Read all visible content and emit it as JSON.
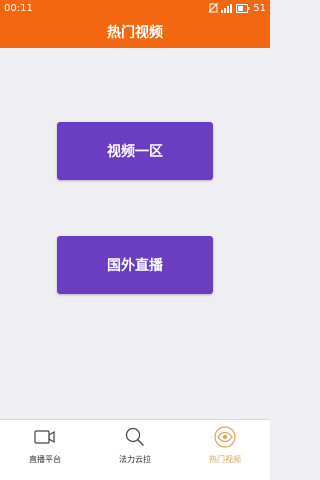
{
  "status": {
    "time": "00:11",
    "battery": "51"
  },
  "header": {
    "title": "热门视频"
  },
  "main": {
    "buttons": [
      {
        "label": "视频一区"
      },
      {
        "label": "国外直播"
      }
    ]
  },
  "tabs": [
    {
      "label": "直播平台",
      "icon": "video-camera-icon"
    },
    {
      "label": "法力云拉",
      "icon": "search-icon"
    },
    {
      "label": "热门视频",
      "icon": "eye-icon",
      "active": true
    }
  ],
  "colors": {
    "accent": "#f2670f",
    "button": "#6a3dc1",
    "active_tab": "#d9a55a",
    "background": "#efeff3"
  }
}
